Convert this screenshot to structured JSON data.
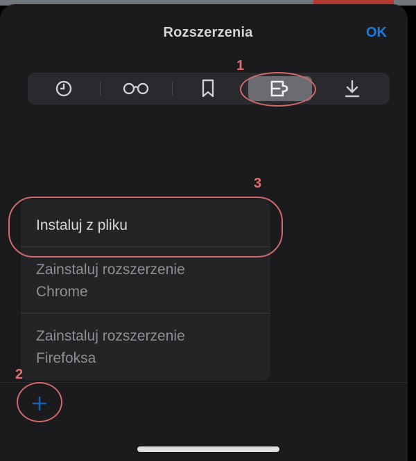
{
  "header": {
    "title": "Rozszerzenia",
    "ok_label": "OK"
  },
  "tabs": [
    {
      "icon": "history-clock-icon",
      "active": false
    },
    {
      "icon": "reading-list-glasses-icon",
      "active": false
    },
    {
      "icon": "bookmark-icon",
      "active": false
    },
    {
      "icon": "extension-puzzle-icon",
      "active": true
    },
    {
      "icon": "download-icon",
      "active": false
    }
  ],
  "menu": {
    "items": [
      {
        "line1": "Instaluj z pliku",
        "line2": ""
      },
      {
        "line1": "Zainstaluj rozszerzenie",
        "line2": "Chrome"
      },
      {
        "line1": "Zainstaluj rozszerzenie",
        "line2": "Firefoksa"
      }
    ]
  },
  "add_button": {
    "icon": "plus-icon"
  },
  "annotations": {
    "a1": "1",
    "a2": "2",
    "a3": "3",
    "color": "#e56f6f"
  },
  "colors": {
    "accent": "#1a7ae6",
    "sheet_bg": "#1b1b1d",
    "active_tab": "#6b6b72"
  }
}
